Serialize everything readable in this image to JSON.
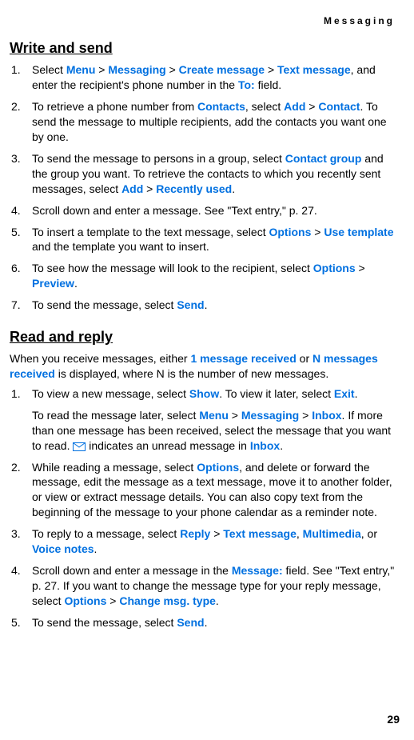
{
  "header": "Messaging",
  "section1": {
    "heading": "Write and send",
    "steps": [
      {
        "pre": "Select ",
        "seq": [
          "Menu",
          " > ",
          "Messaging",
          " > ",
          "Create message",
          " > ",
          "Text message"
        ],
        "post1": ", and enter the recipient's phone number in the ",
        "to": "To:",
        "post2": " field."
      },
      {
        "pre": "To retrieve a phone number from ",
        "contacts": "Contacts",
        "mid1": ", select ",
        "add": "Add",
        "mid2": " > ",
        "contact": "Contact",
        "post": ". To send the message to multiple recipients, add the contacts you want one by one."
      },
      {
        "pre": "To send the message to persons in a group, select ",
        "cg": "Contact group",
        "mid1": " and the group you want. To retrieve the contacts to which you recently sent messages, select ",
        "add": "Add",
        "mid2": " > ",
        "ru": "Recently used",
        "post": "."
      },
      {
        "text": "Scroll down and enter a message. See \"Text entry,\" p. 27."
      },
      {
        "pre": "To insert a template to the text message, select ",
        "opt": "Options",
        "mid": " > ",
        "ut": "Use template",
        "post": " and the template you want to insert."
      },
      {
        "pre": "To see how the message will look to the recipient, select ",
        "opt": "Options",
        "mid": " > ",
        "pv": "Preview",
        "post": "."
      },
      {
        "pre": "To send the message, select ",
        "send": "Send",
        "post": "."
      }
    ]
  },
  "section2": {
    "heading": "Read and reply",
    "intro": {
      "pre": "When you receive messages, either ",
      "one": "1 message received",
      "mid": " or ",
      "n": "N messages received",
      "post": " is displayed, where N is the number of new messages."
    },
    "steps": [
      {
        "pre": "To view a new message, select ",
        "show": "Show",
        "mid": ". To view it later, select ",
        "exit": "Exit",
        "post": ".",
        "sub": {
          "pre": "To read the message later, select ",
          "menu": "Menu",
          "s1": " > ",
          "msg": "Messaging",
          "s2": " > ",
          "inbox": "Inbox",
          "mid1": ". If more than one message has been received, select the message that you want to read. ",
          "mid2": " indicates an unread message in ",
          "inbox2": "Inbox",
          "post": "."
        }
      },
      {
        "pre": "While reading a message, select ",
        "opt": "Options",
        "post": ", and delete or forward the message, edit the message as a text message, move it to another folder, or view or extract message details. You can also copy text from the beginning of the message to your phone calendar as a reminder note."
      },
      {
        "pre": "To reply to a message, select ",
        "reply": "Reply",
        "s1": " > ",
        "tm": "Text message",
        "mid1": ", ",
        "mm": "Multimedia",
        "mid2": ", or ",
        "vn": "Voice notes",
        "post": "."
      },
      {
        "pre": "Scroll down and enter a message in the ",
        "msgfield": "Message:",
        "mid": " field. See \"Text entry,\" p. 27. If you want to change the message type for your reply message, select ",
        "opt": "Options",
        "s1": " > ",
        "cmt": "Change msg. type",
        "post": "."
      },
      {
        "pre": "To send the message, select ",
        "send": "Send",
        "post": "."
      }
    ]
  },
  "page_number": "29"
}
